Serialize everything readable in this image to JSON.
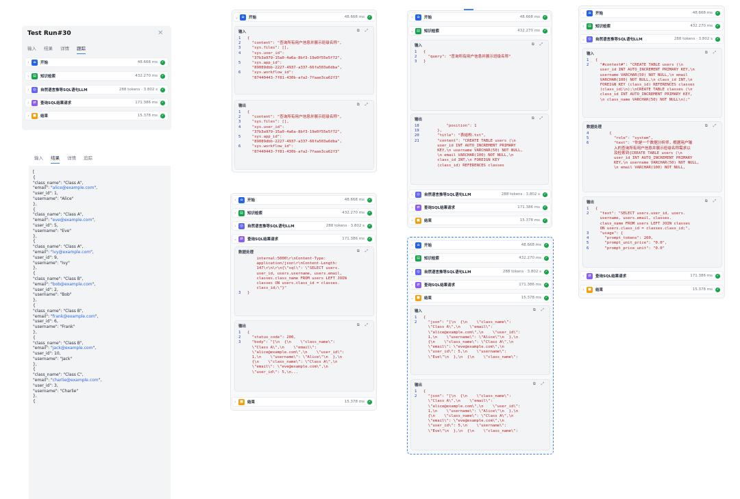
{
  "run_panel": {
    "title": "Test Run#30",
    "tabs": [
      "输入",
      "结果",
      "详情",
      "跟踪"
    ],
    "active_tab": "跟踪"
  },
  "nodes": [
    {
      "name": "开始",
      "metric": "48.668 ms",
      "icon": "home-icon",
      "color": "#2563eb"
    },
    {
      "name": "知识检索",
      "metric": "432.270 ms",
      "icon": "book-icon",
      "color": "#16a34a"
    },
    {
      "name": "自然语言推导SQL语句LLM",
      "metric": "288 tokens · 3.802 s",
      "icon": "llm-icon",
      "color": "#6366f1"
    },
    {
      "name": "查询SQL结果请求",
      "metric": "171.386 ms",
      "icon": "http-icon",
      "color": "#8b5cf6"
    },
    {
      "name": "结束",
      "metric": "15.378 ms",
      "icon": "end-icon",
      "color": "#f59e0b"
    }
  ],
  "result_panel": {
    "tabs": [
      "输入",
      "结果",
      "详情",
      "追踪"
    ],
    "active_tab": "结果",
    "items": [
      {
        "class_name": "Class A",
        "email": "alice@example.com",
        "user_id": "1",
        "username": "Alice"
      },
      {
        "class_name": "Class A",
        "email": "eve@example.com",
        "user_id": "5",
        "username": "Eve"
      },
      {
        "class_name": "Class A",
        "email": "ivy@example.com",
        "user_id": "9",
        "username": "Ivy"
      },
      {
        "class_name": "Class B",
        "email": "bob@example.com",
        "user_id": "2",
        "username": "Bob"
      },
      {
        "class_name": "Class B",
        "email": "frank@example.com",
        "user_id": "6",
        "username": "Frank"
      },
      {
        "class_name": "Class B",
        "email": "jack@example.com",
        "user_id": "10",
        "username": "Jack"
      },
      {
        "class_name": "Class C",
        "email": "charlie@example.com",
        "user_id": "3",
        "username": "Charlie"
      }
    ]
  },
  "labels": {
    "input": "输入",
    "output": "输出",
    "data_processing": "数据处理",
    "query_value": "查询所有用户信息并展示班级名称"
  },
  "start_input_lines": [
    [
      "1",
      "{"
    ],
    [
      "2",
      "  \"content\": \"查询所有用户信息并展示班级名称\","
    ],
    [
      "3",
      "  \"sys.files\": [],"
    ],
    [
      "4",
      "  \"sys.user_id\":"
    ],
    [
      "",
      "  \"37b3a979-15a0-4a6a-8bf3-19e0f55e5f72\","
    ],
    [
      "5",
      "  \"sys.app_id\":"
    ],
    [
      "",
      "  \"89089dbb-2227-4937-a337-66fa503a6dba\","
    ],
    [
      "6",
      "  \"sys.workflow_id\":"
    ],
    [
      "",
      "  \"87440443-7f81-430b-afa2-7faae3ca62f3\""
    ]
  ],
  "http_processing_lines": [
    [
      "",
      "    internal:5000\\r\\nContent-Type:"
    ],
    [
      "",
      "    application/json\\r\\nContent-Length:"
    ],
    [
      "",
      "    147\\r\\n\\r\\n{\\\"sql\\\": \\\"SELECT users."
    ],
    [
      "",
      "    user_id, users.username, users.email,"
    ],
    [
      "",
      "    classes.class_name FROM users LEFT JOIN"
    ],
    [
      "",
      "    classes ON users.class_id = classes."
    ],
    [
      "",
      "    class_id;\\\"}\""
    ],
    [
      "3",
      "}"
    ]
  ],
  "http_output_lines": [
    [
      "1",
      "{"
    ],
    [
      "2",
      "  \"status_code\": 200,"
    ],
    [
      "3",
      "  \"body\": \"[\\n  {\\n    \\\"class_name\\\":"
    ],
    [
      "",
      "  \\\"Class A\\\",\\n    \\\"email\\\":"
    ],
    [
      "",
      "  \\\"alice@example.com\\\",\\n    \\\"user_id\\\":"
    ],
    [
      "",
      "  1,\\n    \\\"username\\\": \\\"Alice\\\"\\n  },\\n"
    ],
    [
      "",
      "  {\\n    \\\"class_name\\\": \\\"Class A\\\",\\n"
    ],
    [
      "",
      "  \\\"email\\\": \\\"eve@example.com\\\",\\n"
    ],
    [
      "",
      "  \\\"user_id\\\": 5,\\n..."
    ]
  ],
  "knowledge_input_lines": [
    [
      "1",
      "{"
    ],
    [
      "2",
      "  \"query\": \"查询所有用户信息并展示班级名称\""
    ],
    [
      "3",
      "}"
    ]
  ],
  "knowledge_output_lines": [
    [
      "18",
      "          \"position\": 1"
    ],
    [
      "19",
      "      },"
    ],
    [
      "20",
      "      \"title\": \"表结构.txt\","
    ],
    [
      "21",
      "      \"content\": \"CREATE TABLE users (\\n"
    ],
    [
      "",
      "      user_id INT AUTO_INCREMENT PRIMARY"
    ],
    [
      "",
      "      KEY,\\n username VARCHAR(50) NOT NULL,"
    ],
    [
      "",
      "      \\n email VARCHAR(100) NOT NULL,\\n"
    ],
    [
      "",
      "      class_id INT,\\n FOREIGN KEY"
    ],
    [
      "",
      "      (class_id) REFERENCES classes"
    ]
  ],
  "end_input_lines": [
    [
      "1",
      "{"
    ],
    [
      "2",
      "  \"json\": \"[\\n  {\\n    \\\"class_name\\\":"
    ],
    [
      "",
      "  \\\"Class A\\\",\\n    \\\"email\\\":"
    ],
    [
      "",
      "  \\\"alice@example.com\\\",\\n    \\\"user_id\\\":"
    ],
    [
      "",
      "  1,\\n    \\\"username\\\": \\\"Alice\\\"\\n  },\\n"
    ],
    [
      "",
      "  {\\n    \\\"class_name\\\": \\\"Class A\\\",\\n"
    ],
    [
      "",
      "  \\\"email\\\": \\\"eve@example.com\\\",\\n"
    ],
    [
      "",
      "  \\\"user_id\\\": 5,\\n    \\\"username\\\":"
    ],
    [
      "",
      "  \\\"Eve\\\"\\n  },\\n  {\\n    \\\"class_name\\\":"
    ]
  ],
  "end_output_lines": [
    [
      "1",
      "{"
    ],
    [
      "2",
      "  \"json\": \"[\\n  {\\n    \\\"class_name\\\":"
    ],
    [
      "",
      "  \\\"Class A\\\",\\n    \\\"email\\\":"
    ],
    [
      "",
      "  \\\"alice@example.com\\\",\\n    \\\"user_id\\\":"
    ],
    [
      "",
      "  1,\\n    \\\"username\\\": \\\"Alice\\\"\\n  },\\n"
    ],
    [
      "",
      "  {\\n    \\\"class_name\\\": \\\"Class A\\\",\\n"
    ],
    [
      "",
      "  \\\"email\\\": \\\"eve@example.com\\\",\\n"
    ],
    [
      "",
      "  \\\"user_id\\\": 5,\\n    \\\"username\\\":"
    ],
    [
      "",
      "  \\\"Eve\\\"\\n  },\\n  {\\n    \\\"class_name\\\":"
    ]
  ],
  "llm_input_lines": [
    [
      "1",
      "{"
    ],
    [
      "2",
      "  \"#context#\": \"CREATE TABLE users (\\n"
    ],
    [
      "",
      "  user_id INT AUTO_INCREMENT PRIMARY KEY,\\n"
    ],
    [
      "",
      "  username VARCHAR(50) NOT NULL,\\n email"
    ],
    [
      "",
      "  VARCHAR(100) NOT NULL,\\n class_id INT,\\n"
    ],
    [
      "",
      "  FOREIGN KEY (class_id) REFERENCES classes"
    ],
    [
      "",
      "  (class_id)\\n);\\nCREATE TABLE classes (\\n"
    ],
    [
      "",
      "  class_id INT AUTO_INCREMENT PRIMARY KEY,"
    ],
    [
      "",
      "  \\n class_name VARCHAR(50) NOT NULL\\n);\""
    ]
  ],
  "llm_processing_lines": [
    [
      "4",
      "      {"
    ],
    [
      "5",
      "        \"role\": \"system\","
    ],
    [
      "6",
      "        \"text\": \"你是一个数据分析师，根据用户输"
    ],
    [
      "",
      "        入的查询所有用户信息并展示班级名称需求以"
    ],
    [
      "",
      "        及检索到{CREATE TABLE users (\\n"
    ],
    [
      "",
      "        user_id INT AUTO_INCREMENT PRIMARY"
    ],
    [
      "",
      "        KEY,\\n username VARCHAR(50) NOT NULL,"
    ],
    [
      "",
      "        \\n email VARCHAR(100) NOT NULL,"
    ]
  ],
  "llm_output_lines": [
    [
      "1",
      "{"
    ],
    [
      "2",
      "  \"text\": \"SELECT users.user_id, users."
    ],
    [
      "",
      "  username, users.email, classes."
    ],
    [
      "",
      "  class_name FROM users LEFT JOIN classes"
    ],
    [
      "",
      "  ON users.class_id = classes.class_id;\","
    ],
    [
      "3",
      "  \"usage\": {"
    ],
    [
      "4",
      "    \"prompt_tokens\": 260,"
    ],
    [
      "5",
      "    \"prompt_unit_price\": \"0.0\","
    ],
    [
      "6",
      "    \"prompt_price_unit\": \"0.0\""
    ]
  ]
}
